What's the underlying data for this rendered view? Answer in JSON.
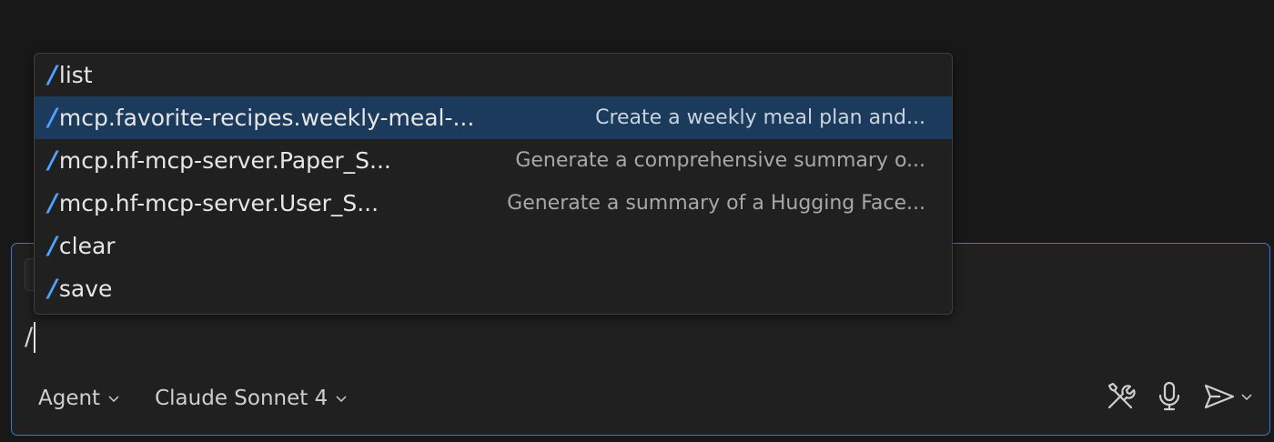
{
  "composer": {
    "input_value": "/",
    "mode_picker": "Agent",
    "model_picker": "Claude Sonnet 4",
    "icons": [
      "tools-icon",
      "microphone-icon",
      "send-icon",
      "chevron-down-icon"
    ],
    "accent_color": "#3a7bd5"
  },
  "slash_menu": {
    "highlight_color": "#1c3b5c",
    "slash_color": "#4da3ff",
    "items": [
      {
        "slash": "/",
        "command": "list",
        "description": ""
      },
      {
        "slash": "/",
        "command": "mcp.favorite-recipes.weekly-meal-...",
        "description": "Create a weekly meal plan and..."
      },
      {
        "slash": "/",
        "command": "mcp.hf-mcp-server.Paper_S...",
        "description": "Generate a comprehensive summary o..."
      },
      {
        "slash": "/",
        "command": "mcp.hf-mcp-server.User_S...",
        "description": "Generate a summary of a Hugging Face..."
      },
      {
        "slash": "/",
        "command": "clear",
        "description": ""
      },
      {
        "slash": "/",
        "command": "save",
        "description": ""
      }
    ]
  }
}
